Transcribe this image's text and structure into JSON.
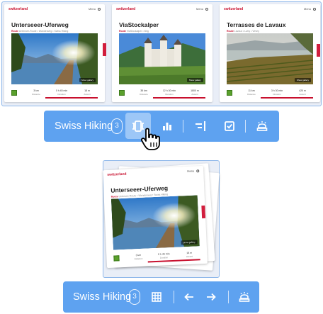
{
  "colors": {
    "toolbar_bg": "#5ea2f0",
    "active_btn": "#9dc7f7",
    "brand_red": "#c8102e",
    "frame": "#8fb8ea"
  },
  "brand": "switzerland",
  "menu_label": "Menu",
  "cards": [
    {
      "title": "Unterseeer-Uferweg",
      "subtitle_lead": "Route",
      "subtitle": "Untersee-Route • Wanderweg • Swiss Hiking",
      "gallery_label": "Show gallery",
      "stats": [
        {
          "value": "3 km",
          "label": "Distance"
        },
        {
          "value": "0 h 45 min",
          "label": "Duration"
        },
        {
          "value": "18 m",
          "label": "Ascent"
        }
      ],
      "scene": "lake"
    },
    {
      "title": "ViaStockalper",
      "subtitle_lead": "Route",
      "subtitle": "ViaStockalper • Brig",
      "gallery_label": "Show gallery",
      "stats": [
        {
          "value": "35 km",
          "label": "Distance"
        },
        {
          "value": "12 h 30 min",
          "label": "Duration"
        },
        {
          "value": "1800 m",
          "label": "Ascent"
        }
      ],
      "scene": "castle"
    },
    {
      "title": "Terrasses de Lavaux",
      "subtitle_lead": "Route",
      "subtitle": "Lavaux • Lutry • Vevey",
      "gallery_label": "Show gallery",
      "stats": [
        {
          "value": "11 km",
          "label": "Distance"
        },
        {
          "value": "3 h 30 min",
          "label": "Duration"
        },
        {
          "value": "420 m",
          "label": "Ascent"
        }
      ],
      "scene": "vineyard"
    }
  ],
  "toolbar_top": {
    "label": "Swiss Hiking",
    "count": "3",
    "buttons": [
      "compare-icon",
      "bar-chart-icon",
      "align-right-icon",
      "checkbox-icon",
      "stack-icon"
    ]
  },
  "toolbar_bottom": {
    "label": "Swiss Hiking",
    "count": "3",
    "buttons": [
      "grid-icon",
      "arrow-left-icon",
      "arrow-right-icon",
      "stack-icon"
    ]
  },
  "stack_card": {
    "title": "Unterseeer-Uferweg",
    "subtitle_lead": "Route",
    "subtitle": "Untersee-Route • Wanderweg • Swiss Hiking",
    "gallery_label": "Show gallery",
    "stats": [
      {
        "value": "3 km",
        "label": "Distance"
      },
      {
        "value": "0 h 45 min",
        "label": "Duration"
      },
      {
        "value": "18 m",
        "label": "Ascent"
      }
    ]
  }
}
